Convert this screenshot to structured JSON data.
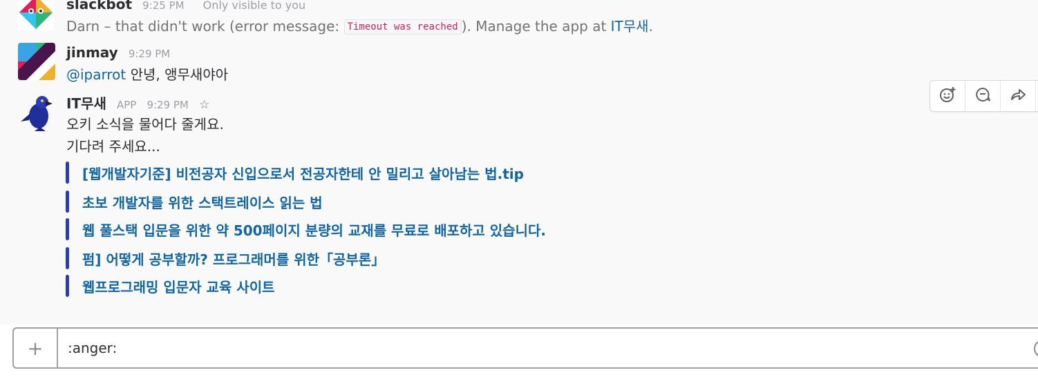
{
  "messages": [
    {
      "sender": "slackbot",
      "time": "9:25 PM",
      "visibility_note": "Only visible to you",
      "text_pre": "Darn – that didn't work (error message: ",
      "code": "Timeout was reached",
      "text_mid": "). Manage the app at ",
      "link": "IT무새",
      "text_post": "."
    },
    {
      "sender": "jinmay",
      "time": "9:29 PM",
      "mention": "@iparrot",
      "text": " 안녕, 앵무새야아"
    },
    {
      "sender": "IT무새",
      "badge": "APP",
      "time": "9:29 PM",
      "star_icon": "☆",
      "line1": "오키 소식을 물어다 줄게요.",
      "line2": "기다려 주세요...",
      "attachments": [
        {
          "title": "[웹개발자기준] 비전공자 신입으로서 전공자한테 안 밀리고 살아남는 법.tip"
        },
        {
          "title": "초보 개발자를 위한 스택트레이스 읽는 법"
        },
        {
          "title": "웹 풀스택 입문을 위한 약 500페이지 분량의 교재를 무료로 배포하고 있습니다."
        },
        {
          "title": "펌] 어떻게 공부할까? 프로그래머를 위한「공부론」"
        },
        {
          "title": "웹프로그래밍 입문자 교육 사이트"
        }
      ]
    }
  ],
  "message_actions": [
    "add-reaction-icon",
    "start-thread-icon",
    "share-message-icon"
  ],
  "composer": {
    "plus": "+",
    "value": ":anger:"
  },
  "colors": {
    "link": "#1264a3",
    "attachment_bar": "#2a3bb5",
    "code_text": "#cc2255"
  }
}
